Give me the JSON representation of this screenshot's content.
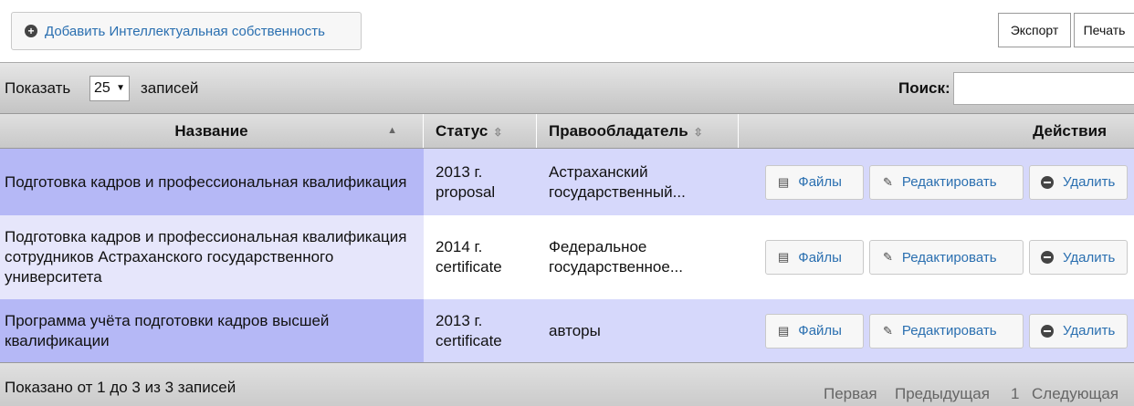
{
  "toolbar": {
    "add_label": "Добавить Интеллектуальная собственность",
    "export_label": "Экспорт",
    "print_label": "Печать"
  },
  "length": {
    "before": "Показать",
    "value": "25",
    "after": "записей"
  },
  "search": {
    "label": "Поиск:",
    "value": ""
  },
  "table": {
    "headers": [
      "Название",
      "Статус",
      "Правообладатель",
      "Действия"
    ],
    "rows": [
      {
        "name": "Подготовка кадров и профессиональная квалификация",
        "status": "2013 г. proposal",
        "owner": "Астраханский государственный..."
      },
      {
        "name": "Подготовка кадров и профессиональная квалификация сотрудников Астраханского государственного университета",
        "status": "2014 г. certificate",
        "owner": "Федеральное государственное..."
      },
      {
        "name": "Программа учёта подготовки кадров высшей квалификации",
        "status": "2013 г. certificate",
        "owner": "авторы"
      }
    ],
    "actions": {
      "files": "Файлы",
      "edit": "Редактировать",
      "delete": "Удалить"
    }
  },
  "footer": {
    "info": "Показано от 1 до 3 из 3 записей",
    "pagination": {
      "first": "Первая",
      "prev": "Предыдущая",
      "page": "1",
      "next": "Следующая"
    }
  },
  "colors": {
    "link": "#2a6fb0",
    "row_odd": "#d6d8fb",
    "row_odd_name": "#b5b8f6",
    "row_even_name": "#e6e6fb"
  },
  "icons": [
    "plus-circle-icon",
    "sort-asc-icon",
    "sort-both-icon",
    "file-icon",
    "pencil-icon",
    "minus-circle-icon",
    "select-arrow-icon"
  ]
}
